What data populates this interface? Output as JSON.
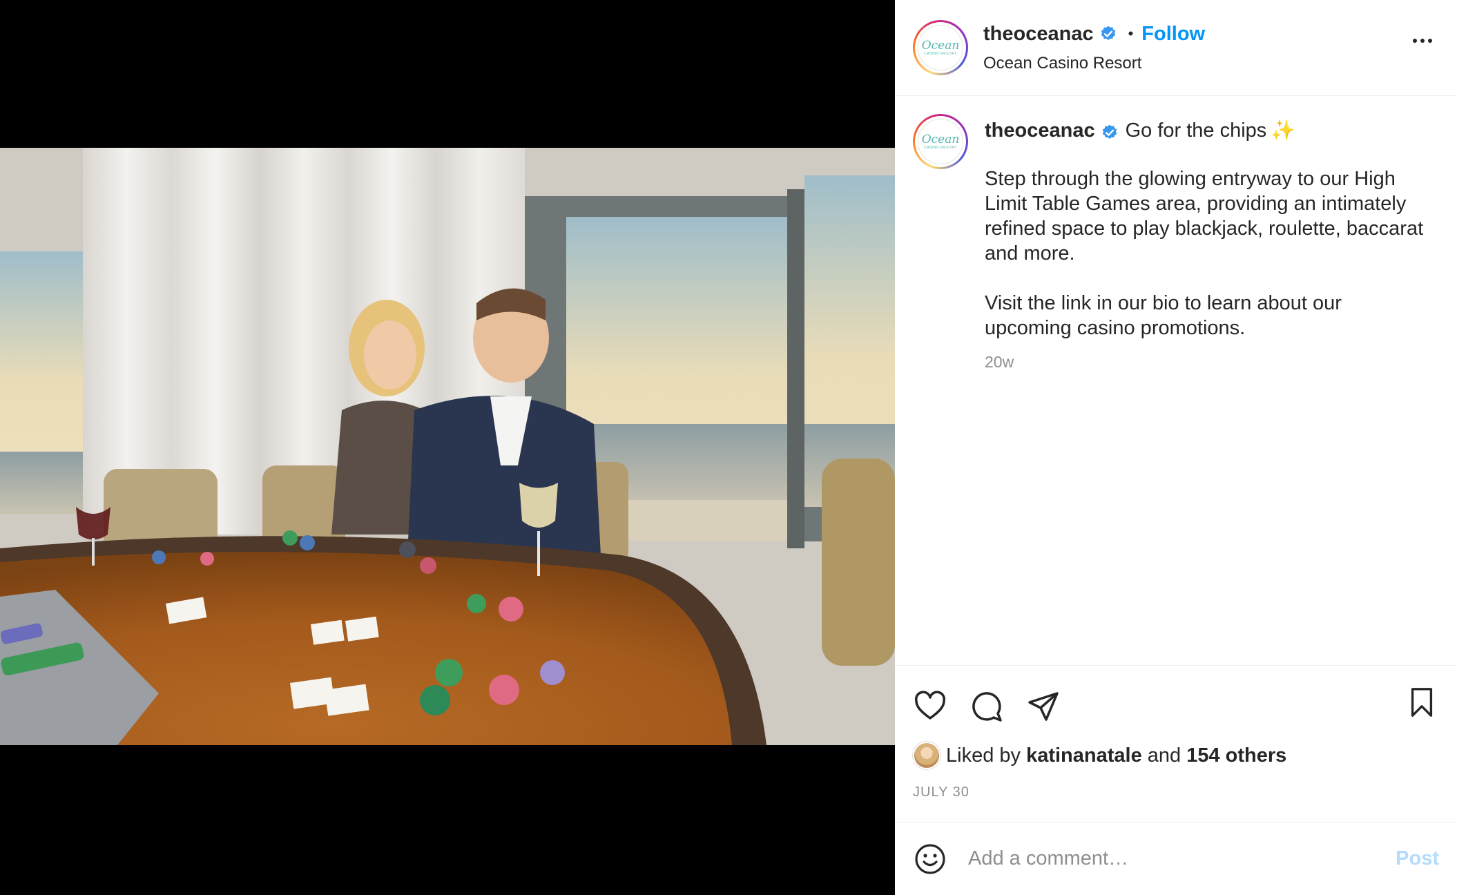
{
  "header": {
    "username": "theoceanac",
    "verified_icon": "verified-badge-icon",
    "separator": "•",
    "follow_label": "Follow",
    "location": "Ocean Casino Resort",
    "logo_word": "Ocean",
    "logo_sub": "CASINO RESORT"
  },
  "caption": {
    "username": "theoceanac",
    "title": "Go for the chips",
    "sparkle": "✨",
    "paragraph1": "Step through the glowing entryway to our High Limit Table Games area, providing an intimately refined space to play blackjack, roulette, baccarat and more.",
    "paragraph2": "Visit the link in our bio to learn about our upcoming casino promotions.",
    "time_ago": "20w"
  },
  "actions": {
    "like_icon": "heart-icon",
    "comment_icon": "comment-bubble-icon",
    "share_icon": "paper-plane-icon",
    "save_icon": "bookmark-icon"
  },
  "likes": {
    "prefix": "Liked by",
    "user": "katinanatale",
    "conjunction": "and",
    "others": "154 others"
  },
  "post_date": "JULY 30",
  "comment": {
    "placeholder": "Add a comment…",
    "post_label": "Post",
    "emoji_icon": "smiley-icon"
  },
  "colors": {
    "accent": "#0095f6",
    "post_disabled": "#b3dbff",
    "text": "#262626",
    "muted": "#8e8e8e"
  }
}
